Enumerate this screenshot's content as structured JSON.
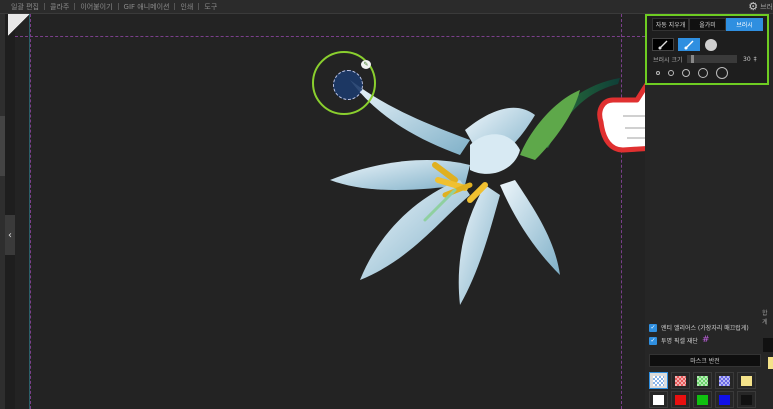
{
  "menu": {
    "items": [
      "일괄 편집",
      "콜라주",
      "이어붙이기",
      "GIF 애니메이션",
      "인쇄",
      "도구"
    ]
  },
  "top_right": {
    "label": "브러"
  },
  "left_panel": {
    "collapse_symbol": "‹"
  },
  "brush_panel": {
    "modes": [
      {
        "label": "자동 지우개",
        "active": false
      },
      {
        "label": "올가미",
        "active": false
      },
      {
        "label": "브러시",
        "active": true
      }
    ],
    "tools": [
      {
        "icon": "brush-restore-icon",
        "active": false
      },
      {
        "icon": "brush-erase-icon",
        "active": true
      },
      {
        "icon": "circle-brush-icon",
        "active": false
      }
    ],
    "size_label": "브러시 크기",
    "size_value": "30",
    "size_unit": "‡",
    "size_level": 0.08
  },
  "options": {
    "antialias_label": "엔티 앨리어스 (가장자리 매끄럽게)",
    "antialias_checked": true,
    "transparent_crop_label": "투명 픽셀 재단",
    "transparent_crop_checked": true
  },
  "mask_button_label": "마스크 반전",
  "swatches": [
    {
      "color": "checker-blue",
      "selected": true
    },
    {
      "color": "#e85a5a"
    },
    {
      "color": "#6bd46b"
    },
    {
      "color": "#6b6be8"
    },
    {
      "color": "#f4e28a"
    },
    {
      "color": "#ffffff"
    },
    {
      "color": "#e81010"
    },
    {
      "color": "#10c010"
    },
    {
      "color": "#1010e8"
    },
    {
      "color": "#111111"
    }
  ],
  "right_edge_label": "합계",
  "colors": {
    "accent": "#2f8fe0",
    "highlight_green": "#6ecc22"
  }
}
